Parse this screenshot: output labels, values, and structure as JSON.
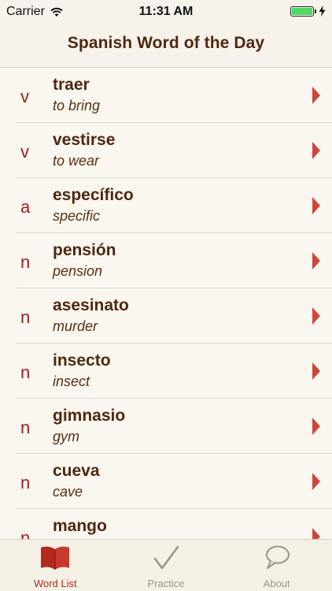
{
  "status_bar": {
    "carrier": "Carrier",
    "time": "11:31 AM",
    "battery_level": 1.0
  },
  "nav": {
    "title": "Spanish Word of the Day"
  },
  "colors": {
    "accent": "#b42a1f",
    "word_text": "#4f2710",
    "pos_text": "#9e1d1d",
    "inactive_tab": "#9a9389"
  },
  "words": [
    {
      "pos": "v",
      "word": "traer",
      "translation": "to bring"
    },
    {
      "pos": "v",
      "word": "vestirse",
      "translation": "to wear"
    },
    {
      "pos": "a",
      "word": "específico",
      "translation": "specific"
    },
    {
      "pos": "n",
      "word": "pensión",
      "translation": "pension"
    },
    {
      "pos": "n",
      "word": "asesinato",
      "translation": "murder"
    },
    {
      "pos": "n",
      "word": "insecto",
      "translation": "insect"
    },
    {
      "pos": "n",
      "word": "gimnasio",
      "translation": "gym"
    },
    {
      "pos": "n",
      "word": "cueva",
      "translation": "cave"
    },
    {
      "pos": "n",
      "word": "mango",
      "translation": ""
    }
  ],
  "tabs": [
    {
      "label": "Word List",
      "icon": "book-icon",
      "active": true
    },
    {
      "label": "Practice",
      "icon": "checkmark-icon",
      "active": false
    },
    {
      "label": "About",
      "icon": "speech-bubble-icon",
      "active": false
    }
  ]
}
